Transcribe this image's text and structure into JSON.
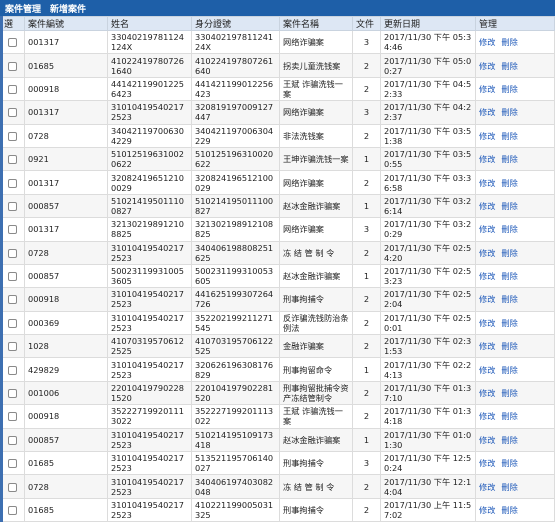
{
  "header": {
    "tabs": [
      "案件管理",
      "新增案件"
    ]
  },
  "table": {
    "columns": [
      "選",
      "案件編號",
      "姓名",
      "身分證號",
      "案件名稱",
      "文件",
      "更新日期",
      "管理"
    ],
    "action_edit": "修改",
    "action_delete": "刪除",
    "rows": [
      {
        "no": "001317",
        "name": "33040219781124124X",
        "id": "33040219781124124X",
        "case": "网络诈骗案",
        "files": "3",
        "date": "2017/11/30 下午 05:34:46"
      },
      {
        "no": "01685",
        "name": "410224197807261640",
        "id": "410224197807261640",
        "case": "拐卖儿童洗钱案",
        "files": "2",
        "date": "2017/11/30 下午 05:00:27"
      },
      {
        "no": "000918",
        "name": "441421199012256423",
        "id": "441421199012256423",
        "case": "王斌 诈骗洗钱一案",
        "files": "2",
        "date": "2017/11/30 下午 04:52:33"
      },
      {
        "no": "001317",
        "name": "310104195402172523",
        "id": "320819197009127447",
        "case": "网络诈骗案",
        "files": "3",
        "date": "2017/11/30 下午 04:22:37"
      },
      {
        "no": "0728",
        "name": "340421197006304229",
        "id": "340421197006304229",
        "case": "非法洗钱案",
        "files": "2",
        "date": "2017/11/30 下午 03:51:38"
      },
      {
        "no": "0921",
        "name": "510125196310020622",
        "id": "510125196310020622",
        "case": "王坤诈骗洗钱一案",
        "files": "1",
        "date": "2017/11/30 下午 03:50:55"
      },
      {
        "no": "001317",
        "name": "320824196512100029",
        "id": "320824196512100029",
        "case": "网络诈骗案",
        "files": "2",
        "date": "2017/11/30 下午 03:36:58"
      },
      {
        "no": "000857",
        "name": "510214195011100827",
        "id": "510214195011100827",
        "case": "赵冰金融诈骗案",
        "files": "1",
        "date": "2017/11/30 下午 03:26:14"
      },
      {
        "no": "001317",
        "name": "321302198912108825",
        "id": "321302198912108825",
        "case": "网络诈骗案",
        "files": "3",
        "date": "2017/11/30 下午 03:20:29"
      },
      {
        "no": "0728",
        "name": "310104195402172523",
        "id": "340406198808251625",
        "case": "冻 结 管 制 令",
        "files": "2",
        "date": "2017/11/30 下午 02:54:20"
      },
      {
        "no": "000857",
        "name": "500231199310053605",
        "id": "500231199310053605",
        "case": "赵冰金融诈骗案",
        "files": "1",
        "date": "2017/11/30 下午 02:53:23"
      },
      {
        "no": "000918",
        "name": "310104195402172523",
        "id": "441625199307264726",
        "case": "刑事拘捕令",
        "files": "2",
        "date": "2017/11/30 下午 02:52:04"
      },
      {
        "no": "000369",
        "name": "310104195402172523",
        "id": "352202199211271545",
        "case": "反诈骗洗钱防治条例法",
        "files": "2",
        "date": "2017/11/30 下午 02:50:01"
      },
      {
        "no": "1028",
        "name": "410703195706122525",
        "id": "410703195706122525",
        "case": "金融诈骗案",
        "files": "2",
        "date": "2017/11/30 下午 02:31:53"
      },
      {
        "no": "429829",
        "name": "310104195402172523",
        "id": "320626196308176829",
        "case": "刑事拘留命令",
        "files": "1",
        "date": "2017/11/30 下午 02:24:13"
      },
      {
        "no": "001006",
        "name": "220104197902281520",
        "id": "220104197902281520",
        "case": "刑事拘留批捕令资产冻结管制令",
        "files": "2",
        "date": "2017/11/30 下午 01:37:10"
      },
      {
        "no": "000918",
        "name": "352227199201113022",
        "id": "352227199201113022",
        "case": "王斌 诈骗洗钱一案",
        "files": "2",
        "date": "2017/11/30 下午 01:34:18"
      },
      {
        "no": "000857",
        "name": "310104195402172523",
        "id": "510214195109173418",
        "case": "赵冰金融诈骗案",
        "files": "1",
        "date": "2017/11/30 下午 01:01:30"
      },
      {
        "no": "01685",
        "name": "310104195402172523",
        "id": "513521195706140027",
        "case": "刑事拘捕令",
        "files": "3",
        "date": "2017/11/30 下午 12:50:24"
      },
      {
        "no": "0728",
        "name": "310104195402172523",
        "id": "340406197403082048",
        "case": "冻 结 管 制 令",
        "files": "2",
        "date": "2017/11/30 下午 12:14:04"
      },
      {
        "no": "01685",
        "name": "310104195402172523",
        "id": "410221199005031325",
        "case": "刑事拘捕令",
        "files": "2",
        "date": "2017/11/30 上午 11:57:02"
      }
    ]
  }
}
